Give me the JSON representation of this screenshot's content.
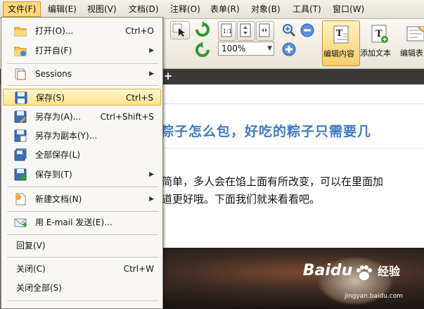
{
  "menubar": {
    "items": [
      "文件(F)",
      "编辑(E)",
      "视图(V)",
      "文档(D)",
      "注释(O)",
      "表单(R)",
      "对象(B)",
      "工具(T)",
      "窗口(W)"
    ]
  },
  "toolbar": {
    "zoom_value": "100%",
    "edit_content_label": "编辑内容",
    "add_text_label": "添加文本",
    "edit_form_label": "编辑表"
  },
  "file_menu": {
    "items": [
      {
        "label": "打开(O)...",
        "shortcut": "Ctrl+O",
        "icon": "folder-open-icon"
      },
      {
        "label": "打开自(F)",
        "submenu": "▶",
        "icon": "folder-from-icon"
      },
      {
        "label": "Sessions",
        "submenu": "▶",
        "icon": "sessions-icon"
      },
      {
        "label": "保存(S)",
        "shortcut": "Ctrl+S",
        "icon": "floppy-disk-icon",
        "highlighted": true
      },
      {
        "label": "另存为(A)...",
        "shortcut": "Ctrl+Shift+S",
        "icon": "save-as-icon"
      },
      {
        "label": "另存为副本(Y)...",
        "icon": "save-copy-icon"
      },
      {
        "label": "全部保存(L)",
        "icon": "save-all-icon"
      },
      {
        "label": "保存到(T)",
        "submenu": "▶",
        "icon": "save-to-icon"
      },
      {
        "label": "新建文档(N)",
        "submenu": "▶",
        "icon": "new-document-icon"
      },
      {
        "label": "用 E-mail 发送(E)...",
        "icon": "email-icon"
      },
      {
        "label": "回复(V)"
      },
      {
        "label": "关闭(C)",
        "shortcut": "Ctrl+W"
      },
      {
        "label": "关闭全部(S)"
      }
    ]
  },
  "document": {
    "title_fragment": "粽子怎么包，好吃的粽子只需要几",
    "body_line_1": "简单，多人会在馅上面有所改变，可以在里面加",
    "body_line_2": "道更好哦。下面我们就来看看吧。"
  },
  "watermark": {
    "brand": "Baidu",
    "jingyan": "经验",
    "url": "jingyan.baidu.com"
  },
  "colors": {
    "title_blue": "#3e7bc1",
    "menu_highlight": "#ffe38a",
    "tabstrip": "#3b3936"
  }
}
